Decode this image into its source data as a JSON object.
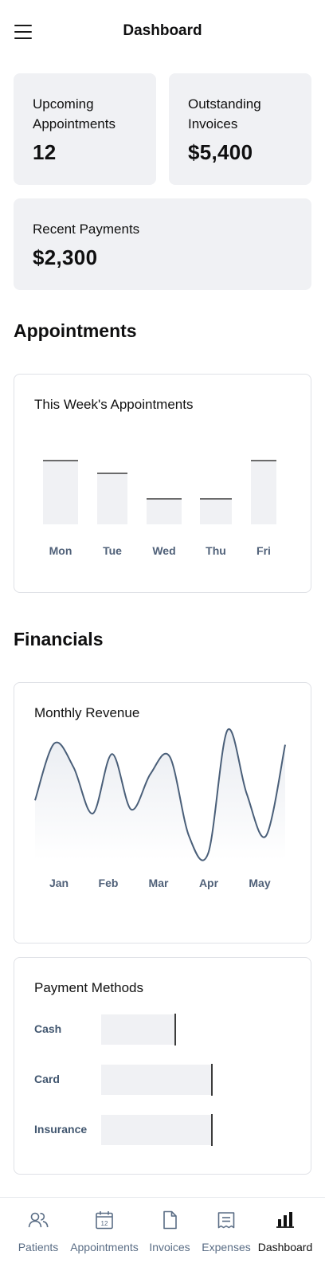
{
  "header": {
    "title": "Dashboard",
    "menu_icon": "hamburger-menu-icon"
  },
  "stats": {
    "upcoming": {
      "label": "Upcoming Appointments",
      "value": "12"
    },
    "outstanding": {
      "label": "Outstanding Invoices",
      "value": "$5,400"
    },
    "payments": {
      "label": "Recent Payments",
      "value": "$2,300"
    }
  },
  "sections": {
    "appointments": "Appointments",
    "financials": "Financials"
  },
  "weekly_chart": {
    "title": "This Week's Appointments"
  },
  "revenue_chart": {
    "title": "Monthly Revenue"
  },
  "payment_methods": {
    "title": "Payment Methods",
    "rows": [
      {
        "label": "Cash",
        "fraction": 0.47
      },
      {
        "label": "Card",
        "fraction": 0.71
      },
      {
        "label": "Insurance",
        "fraction": 0.71
      }
    ]
  },
  "chart_data": [
    {
      "type": "bar",
      "title": "This Week's Appointments",
      "categories": [
        "Mon",
        "Tue",
        "Wed",
        "Thu",
        "Fri"
      ],
      "values": [
        5,
        4,
        2,
        2,
        5
      ],
      "ylim": [
        0,
        7
      ]
    },
    {
      "type": "area",
      "title": "Monthly Revenue",
      "x_ticks": [
        "Jan",
        "Feb",
        "Mar",
        "Apr",
        "May"
      ],
      "values": [
        0.45,
        0.88,
        0.7,
        0.35,
        0.8,
        0.38,
        0.65,
        0.78,
        0.18,
        0.05,
        0.98,
        0.5,
        0.18,
        0.87
      ],
      "ylim": [
        0,
        1
      ]
    }
  ],
  "nav": {
    "items": [
      {
        "label": "Patients",
        "icon": "users-icon"
      },
      {
        "label": "Appointments",
        "icon": "calendar-icon",
        "calendar_day": "12"
      },
      {
        "label": "Invoices",
        "icon": "file-icon"
      },
      {
        "label": "Expenses",
        "icon": "receipt-icon"
      },
      {
        "label": "Dashboard",
        "icon": "bar-chart-icon"
      }
    ],
    "active": "Dashboard"
  },
  "colors": {
    "card_bg": "#f0f1f4",
    "line": "#4a5f79",
    "axis_text": "#506179",
    "nav_inactive": "#5a6d85",
    "nav_active": "#111111"
  }
}
